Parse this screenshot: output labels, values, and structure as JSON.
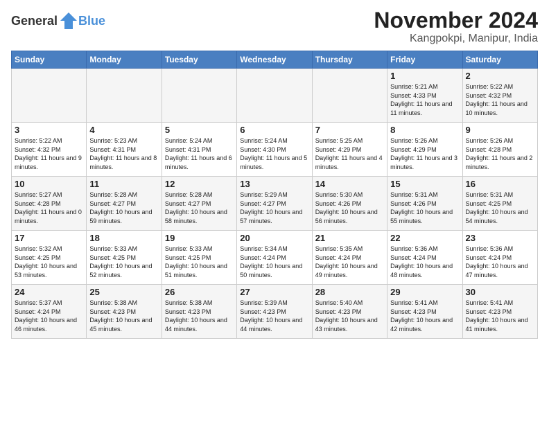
{
  "logo": {
    "general": "General",
    "blue": "Blue"
  },
  "title": "November 2024",
  "location": "Kangpokpi, Manipur, India",
  "headers": [
    "Sunday",
    "Monday",
    "Tuesday",
    "Wednesday",
    "Thursday",
    "Friday",
    "Saturday"
  ],
  "rows": [
    [
      {
        "day": "",
        "content": ""
      },
      {
        "day": "",
        "content": ""
      },
      {
        "day": "",
        "content": ""
      },
      {
        "day": "",
        "content": ""
      },
      {
        "day": "",
        "content": ""
      },
      {
        "day": "1",
        "content": "Sunrise: 5:21 AM\nSunset: 4:33 PM\nDaylight: 11 hours\nand 11 minutes."
      },
      {
        "day": "2",
        "content": "Sunrise: 5:22 AM\nSunset: 4:32 PM\nDaylight: 11 hours\nand 10 minutes."
      }
    ],
    [
      {
        "day": "3",
        "content": "Sunrise: 5:22 AM\nSunset: 4:32 PM\nDaylight: 11 hours\nand 9 minutes."
      },
      {
        "day": "4",
        "content": "Sunrise: 5:23 AM\nSunset: 4:31 PM\nDaylight: 11 hours\nand 8 minutes."
      },
      {
        "day": "5",
        "content": "Sunrise: 5:24 AM\nSunset: 4:31 PM\nDaylight: 11 hours\nand 6 minutes."
      },
      {
        "day": "6",
        "content": "Sunrise: 5:24 AM\nSunset: 4:30 PM\nDaylight: 11 hours\nand 5 minutes."
      },
      {
        "day": "7",
        "content": "Sunrise: 5:25 AM\nSunset: 4:29 PM\nDaylight: 11 hours\nand 4 minutes."
      },
      {
        "day": "8",
        "content": "Sunrise: 5:26 AM\nSunset: 4:29 PM\nDaylight: 11 hours\nand 3 minutes."
      },
      {
        "day": "9",
        "content": "Sunrise: 5:26 AM\nSunset: 4:28 PM\nDaylight: 11 hours\nand 2 minutes."
      }
    ],
    [
      {
        "day": "10",
        "content": "Sunrise: 5:27 AM\nSunset: 4:28 PM\nDaylight: 11 hours\nand 0 minutes."
      },
      {
        "day": "11",
        "content": "Sunrise: 5:28 AM\nSunset: 4:27 PM\nDaylight: 10 hours\nand 59 minutes."
      },
      {
        "day": "12",
        "content": "Sunrise: 5:28 AM\nSunset: 4:27 PM\nDaylight: 10 hours\nand 58 minutes."
      },
      {
        "day": "13",
        "content": "Sunrise: 5:29 AM\nSunset: 4:27 PM\nDaylight: 10 hours\nand 57 minutes."
      },
      {
        "day": "14",
        "content": "Sunrise: 5:30 AM\nSunset: 4:26 PM\nDaylight: 10 hours\nand 56 minutes."
      },
      {
        "day": "15",
        "content": "Sunrise: 5:31 AM\nSunset: 4:26 PM\nDaylight: 10 hours\nand 55 minutes."
      },
      {
        "day": "16",
        "content": "Sunrise: 5:31 AM\nSunset: 4:25 PM\nDaylight: 10 hours\nand 54 minutes."
      }
    ],
    [
      {
        "day": "17",
        "content": "Sunrise: 5:32 AM\nSunset: 4:25 PM\nDaylight: 10 hours\nand 53 minutes."
      },
      {
        "day": "18",
        "content": "Sunrise: 5:33 AM\nSunset: 4:25 PM\nDaylight: 10 hours\nand 52 minutes."
      },
      {
        "day": "19",
        "content": "Sunrise: 5:33 AM\nSunset: 4:25 PM\nDaylight: 10 hours\nand 51 minutes."
      },
      {
        "day": "20",
        "content": "Sunrise: 5:34 AM\nSunset: 4:24 PM\nDaylight: 10 hours\nand 50 minutes."
      },
      {
        "day": "21",
        "content": "Sunrise: 5:35 AM\nSunset: 4:24 PM\nDaylight: 10 hours\nand 49 minutes."
      },
      {
        "day": "22",
        "content": "Sunrise: 5:36 AM\nSunset: 4:24 PM\nDaylight: 10 hours\nand 48 minutes."
      },
      {
        "day": "23",
        "content": "Sunrise: 5:36 AM\nSunset: 4:24 PM\nDaylight: 10 hours\nand 47 minutes."
      }
    ],
    [
      {
        "day": "24",
        "content": "Sunrise: 5:37 AM\nSunset: 4:24 PM\nDaylight: 10 hours\nand 46 minutes."
      },
      {
        "day": "25",
        "content": "Sunrise: 5:38 AM\nSunset: 4:23 PM\nDaylight: 10 hours\nand 45 minutes."
      },
      {
        "day": "26",
        "content": "Sunrise: 5:38 AM\nSunset: 4:23 PM\nDaylight: 10 hours\nand 44 minutes."
      },
      {
        "day": "27",
        "content": "Sunrise: 5:39 AM\nSunset: 4:23 PM\nDaylight: 10 hours\nand 44 minutes."
      },
      {
        "day": "28",
        "content": "Sunrise: 5:40 AM\nSunset: 4:23 PM\nDaylight: 10 hours\nand 43 minutes."
      },
      {
        "day": "29",
        "content": "Sunrise: 5:41 AM\nSunset: 4:23 PM\nDaylight: 10 hours\nand 42 minutes."
      },
      {
        "day": "30",
        "content": "Sunrise: 5:41 AM\nSunset: 4:23 PM\nDaylight: 10 hours\nand 41 minutes."
      }
    ]
  ]
}
